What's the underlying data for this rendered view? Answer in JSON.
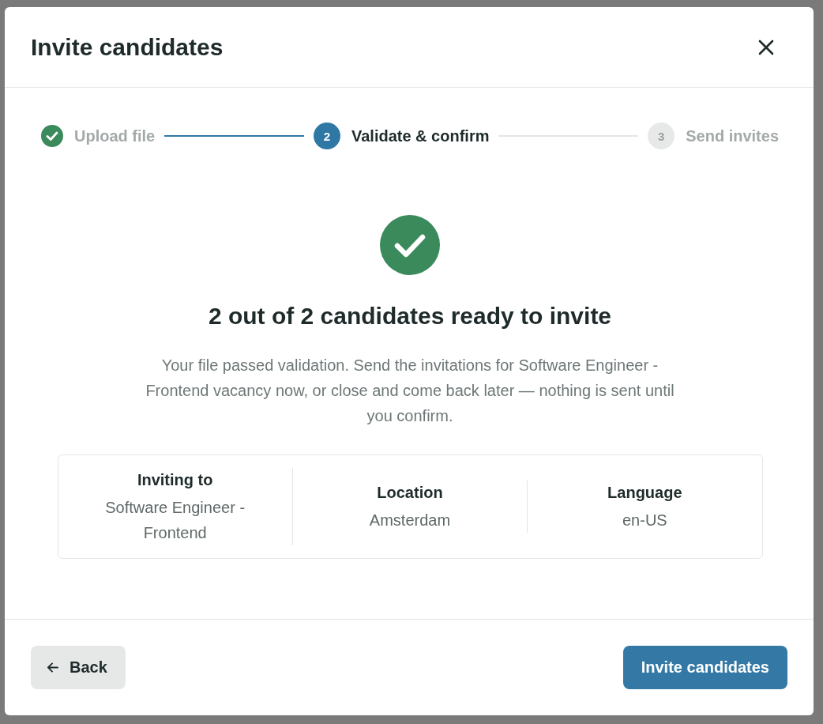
{
  "dialog": {
    "title": "Invite candidates"
  },
  "steps": [
    {
      "label": "Upload file",
      "completed": true,
      "selected": false
    },
    {
      "number": "2",
      "label": "Validate & confirm",
      "completed": false,
      "selected": true
    },
    {
      "number": "3",
      "label": "Send invites",
      "completed": false,
      "selected": false
    }
  ],
  "result": {
    "heading": "2 out of 2 candidates ready to invite",
    "message": "Your file passed validation. Send the invitations for Software Engineer - Frontend vacancy now, or close and come back later — nothing is sent until you confirm."
  },
  "summary": [
    {
      "label": "Inviting to",
      "value": "Software Engineer - Frontend"
    },
    {
      "label": "Location",
      "value": "Amsterdam"
    },
    {
      "label": "Language",
      "value": "en-US"
    }
  ],
  "footer": {
    "back_button": "Back",
    "primary_button": "Invite candidates"
  }
}
